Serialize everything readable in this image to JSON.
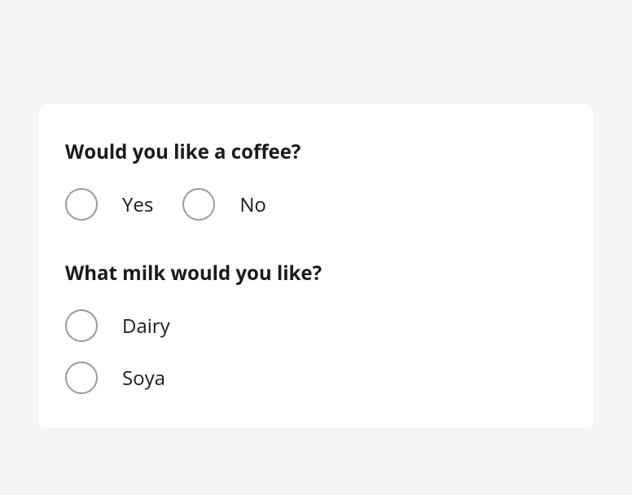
{
  "q1": {
    "question": "Would you like a coffee?",
    "options": [
      {
        "label": "Yes"
      },
      {
        "label": "No"
      }
    ]
  },
  "q2": {
    "question": "What milk would you like?",
    "options": [
      {
        "label": "Dairy"
      },
      {
        "label": "Soya"
      }
    ]
  }
}
